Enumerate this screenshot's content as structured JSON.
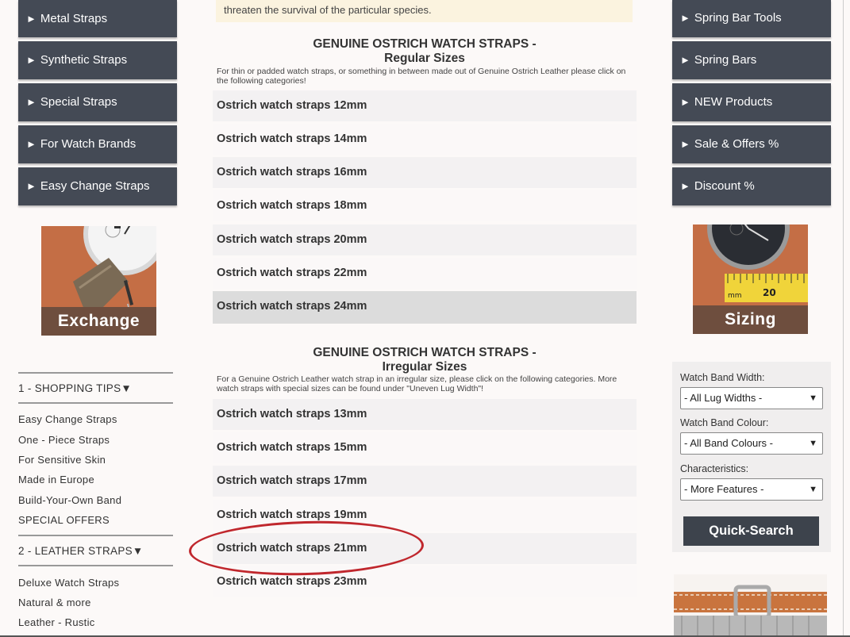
{
  "left_nav": [
    {
      "label": "Metal Straps"
    },
    {
      "label": "Synthetic Straps"
    },
    {
      "label": "Special Straps"
    },
    {
      "label": "For Watch Brands"
    },
    {
      "label": "Easy Change Straps"
    }
  ],
  "right_nav": [
    {
      "label": "Spring Bar Tools"
    },
    {
      "label": "Spring Bars"
    },
    {
      "label": "NEW Products"
    },
    {
      "label": "Sale & Offers %"
    },
    {
      "label": "Discount %"
    }
  ],
  "nav_arrow": "►",
  "promo": {
    "exchange_label": "Exchange",
    "sizing_label": "Sizing",
    "ruler_left": "mm",
    "ruler_right": "20"
  },
  "shopping_tips": {
    "heading": "1 - SHOPPING TIPS▼",
    "links": [
      "Easy Change Straps",
      "One - Piece Straps",
      "For Sensitive Skin",
      "Made in Europe",
      "Build-Your-Own Band",
      "SPECIAL OFFERS"
    ]
  },
  "leather_straps": {
    "heading": "2 - LEATHER STRAPS▼",
    "links": [
      "Deluxe Watch Straps",
      "Natural & more",
      "Leather - Rustic"
    ]
  },
  "notice_text": "threaten the survival of the particular species.",
  "regular": {
    "title_line1": "GENUINE OSTRICH WATCH STRAPS -",
    "title_line2": "Regular Sizes",
    "description": "For thin or padded watch straps, or something in between made out of Genuine Ostrich Leather please click on the following categories!",
    "items": [
      "Ostrich watch straps 12mm",
      "Ostrich watch straps 14mm",
      "Ostrich watch straps 16mm",
      "Ostrich watch straps 18mm",
      "Ostrich watch straps 20mm",
      "Ostrich watch straps 22mm",
      "Ostrich watch straps 24mm"
    ]
  },
  "irregular": {
    "title_line1": "GENUINE OSTRICH WATCH STRAPS -",
    "title_line2": "Irregular Sizes",
    "description": "For a Genuine Ostrich Leather watch strap in an irregular size, please click on the following categories. More watch straps with special sizes can be found under \"Uneven Lug Width\"!",
    "items": [
      "Ostrich watch straps 13mm",
      "Ostrich watch straps 15mm",
      "Ostrich watch straps 17mm",
      "Ostrich watch straps 19mm",
      "Ostrich watch straps 21mm",
      "Ostrich watch straps 23mm"
    ]
  },
  "filters": {
    "width_label": "Watch Band Width:",
    "width_value": "- All Lug Widths -",
    "colour_label": "Watch Band Colour:",
    "colour_value": "- All Band Colours -",
    "char_label": "Characteristics:",
    "char_value": "- More Features -",
    "button": "Quick-Search"
  },
  "colors": {
    "nav_bg": "#444a55",
    "annotation": "#c0272d"
  }
}
